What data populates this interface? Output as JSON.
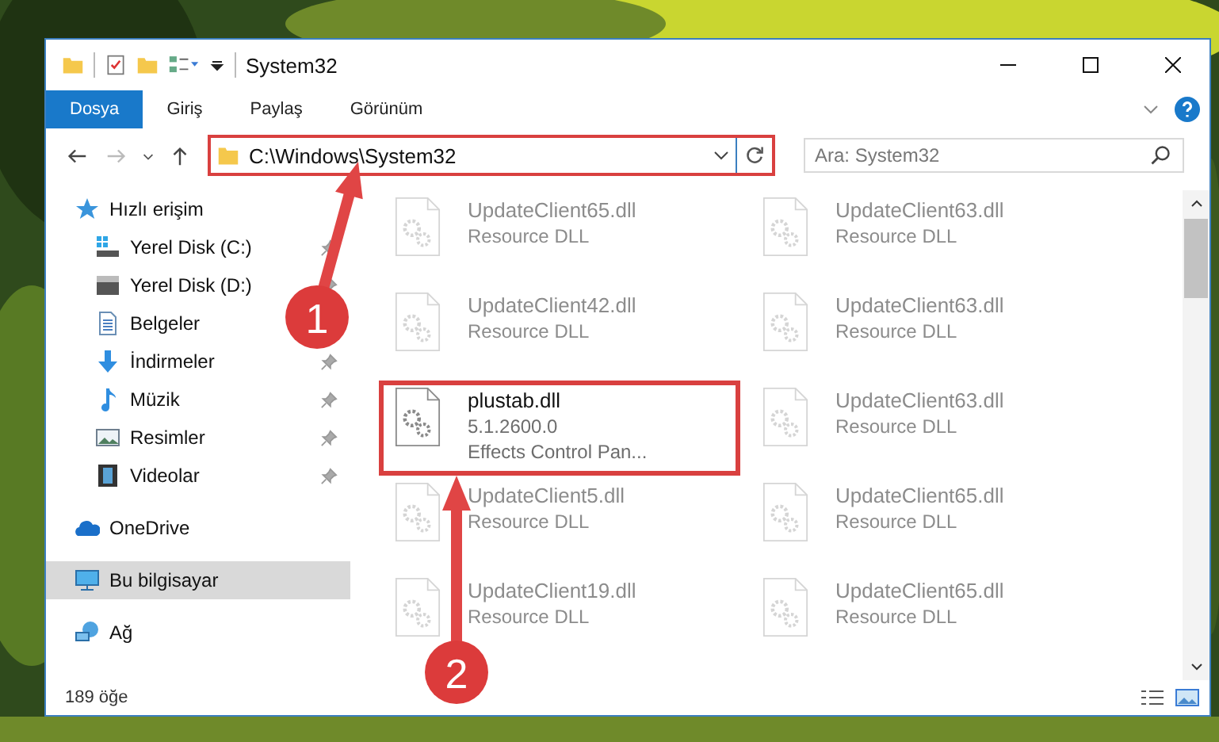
{
  "window": {
    "title": "System32"
  },
  "ribbon_tabs": [
    {
      "label": "Dosya",
      "selected": true
    },
    {
      "label": "Giriş",
      "selected": false
    },
    {
      "label": "Paylaş",
      "selected": false
    },
    {
      "label": "Görünüm",
      "selected": false
    }
  ],
  "address": {
    "path": "C:\\Windows\\System32"
  },
  "search": {
    "placeholder": "Ara: System32"
  },
  "sidebar": {
    "items": [
      {
        "label": "Hızlı erişim",
        "kind": "star",
        "selected": false,
        "children": [
          {
            "label": "Yerel Disk (C:)",
            "kind": "drive-windows",
            "pinned": true,
            "selected": false
          },
          {
            "label": "Yerel Disk (D:)",
            "kind": "drive",
            "pinned": true,
            "selected": false
          },
          {
            "label": "Belgeler",
            "kind": "documents",
            "pinned": false,
            "selected": false
          },
          {
            "label": "İndirmeler",
            "kind": "download",
            "pinned": true,
            "selected": false
          },
          {
            "label": "Müzik",
            "kind": "music",
            "pinned": true,
            "selected": false
          },
          {
            "label": "Resimler",
            "kind": "pictures",
            "pinned": true,
            "selected": false
          },
          {
            "label": "Videolar",
            "kind": "videos",
            "pinned": true,
            "selected": false
          }
        ]
      },
      {
        "label": "OneDrive",
        "kind": "cloud",
        "selected": false
      },
      {
        "label": "Bu bilgisayar",
        "kind": "computer",
        "selected": true
      },
      {
        "label": "Ağ",
        "kind": "network",
        "selected": false
      }
    ]
  },
  "files": [
    {
      "name": "UpdateClient65.dll",
      "lines": [
        "Resource DLL"
      ],
      "blurred": true,
      "highlighted": false
    },
    {
      "name": "UpdateClient63.dll",
      "lines": [
        "Resource DLL"
      ],
      "blurred": true,
      "highlighted": false
    },
    {
      "name": "UpdateClient42.dll",
      "lines": [
        "Resource DLL"
      ],
      "blurred": true,
      "highlighted": false
    },
    {
      "name": "UpdateClient63.dll",
      "lines": [
        "Resource DLL"
      ],
      "blurred": true,
      "highlighted": false
    },
    {
      "name": "plustab.dll",
      "lines": [
        "5.1.2600.0",
        "Effects Control Pan..."
      ],
      "blurred": false,
      "highlighted": true
    },
    {
      "name": "UpdateClient63.dll",
      "lines": [
        "Resource DLL"
      ],
      "blurred": true,
      "highlighted": false
    },
    {
      "name": "UpdateClient5.dll",
      "lines": [
        "Resource DLL"
      ],
      "blurred": true,
      "highlighted": false
    },
    {
      "name": "UpdateClient65.dll",
      "lines": [
        "Resource DLL"
      ],
      "blurred": true,
      "highlighted": false
    },
    {
      "name": "UpdateClient19.dll",
      "lines": [
        "Resource DLL"
      ],
      "blurred": true,
      "highlighted": false
    },
    {
      "name": "UpdateClient65.dll",
      "lines": [
        "Resource DLL"
      ],
      "blurred": true,
      "highlighted": false
    }
  ],
  "status_bar": {
    "count": "189 öğe"
  },
  "annotations": [
    {
      "number": "1"
    },
    {
      "number": "2"
    }
  ]
}
